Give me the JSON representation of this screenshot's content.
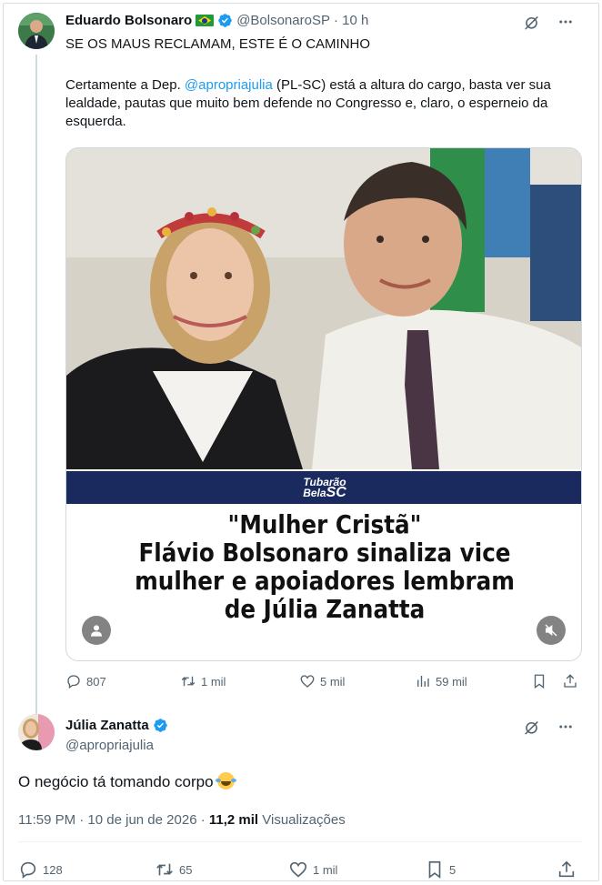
{
  "parent": {
    "name": "Eduardo Bolsonaro",
    "handle": "@BolsonaroSP",
    "time": "· 10 h",
    "headline": "SE OS MAUS RECLAMAM, ESTE É O CAMINHO",
    "body_before": "Certamente a Dep. ",
    "mention": "@apropriajulia",
    "body_after": " (PL-SC) está a altura do cargo, basta ver sua lealdade, pautas que muito bem defende no Congresso e, claro, o esperneio da esquerda.",
    "media": {
      "brand_line1": "Tubarão",
      "brand_line2": "Bela",
      "brand_sc": "SC",
      "caption_lines": [
        "\"Mulher Cristã\"",
        "Flávio Bolsonaro sinaliza vice",
        "mulher e apoiadores lembram",
        "de Júlia Zanatta"
      ]
    },
    "actions": {
      "replies": "807",
      "reposts": "1 mil",
      "likes": "5 mil",
      "views": "59 mil"
    }
  },
  "main": {
    "name": "Júlia Zanatta",
    "handle": "@apropriajulia",
    "text": "O negócio tá tomando corpo ",
    "timestamp": "11:59 PM · 10 de jun de 2026 · ",
    "views_count": "11,2 mil",
    "views_label": " Visualizações",
    "actions": {
      "replies": "128",
      "reposts": "65",
      "likes": "1 mil",
      "bookmarks": "5"
    }
  },
  "icons": {
    "verified": "verified-badge-icon",
    "grok": "grok-icon",
    "more": "more-icon",
    "reply": "reply-icon",
    "repost": "repost-icon",
    "like": "heart-icon",
    "views": "views-icon",
    "bookmark": "bookmark-icon",
    "share": "share-icon"
  },
  "colors": {
    "accent": "#1d9bf0",
    "secondary_text": "#536471",
    "primary_text": "#0f1419",
    "banner": "#1a2a5e"
  }
}
